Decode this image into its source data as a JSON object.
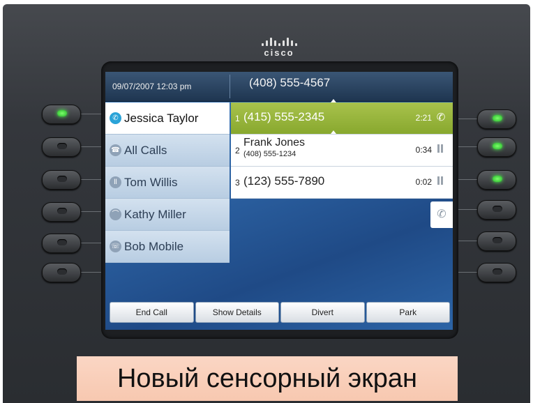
{
  "brand": {
    "logo_text": "cisco"
  },
  "header": {
    "datetime": "09/07/2007 12:03 pm",
    "number": "(408) 555-4567"
  },
  "lines": [
    {
      "label": "Jessica Taylor",
      "icon": "line-icon",
      "selected": true
    },
    {
      "label": "All Calls",
      "icon": "all-calls-icon",
      "selected": false
    },
    {
      "label": "Tom Willis",
      "icon": "hold-icon",
      "selected": false
    },
    {
      "label": "Kathy Miller",
      "icon": "hangup-icon",
      "selected": false
    },
    {
      "label": "Bob Mobile",
      "icon": "mobile-icon",
      "selected": false
    }
  ],
  "calls": [
    {
      "index": "1",
      "name": "(415) 555-2345",
      "sub": "",
      "time": "2:21",
      "state": "active"
    },
    {
      "index": "2",
      "name": "Frank Jones",
      "sub": "(408) 555-1234",
      "time": "0:34",
      "state": "hold"
    },
    {
      "index": "3",
      "name": "(123) 555-7890",
      "sub": "",
      "time": "0:02",
      "state": "hold"
    }
  ],
  "softkeys": {
    "end_call": "End Call",
    "show_details": "Show Details",
    "divert": "Divert",
    "park": "Park"
  },
  "caption": "Новый сенсорный экран",
  "colors": {
    "active_call": "#9bb83e",
    "led_on": "#3fd43a",
    "caption_bg": "#f9cfb9",
    "screen_bg": "#2a5e9e"
  }
}
